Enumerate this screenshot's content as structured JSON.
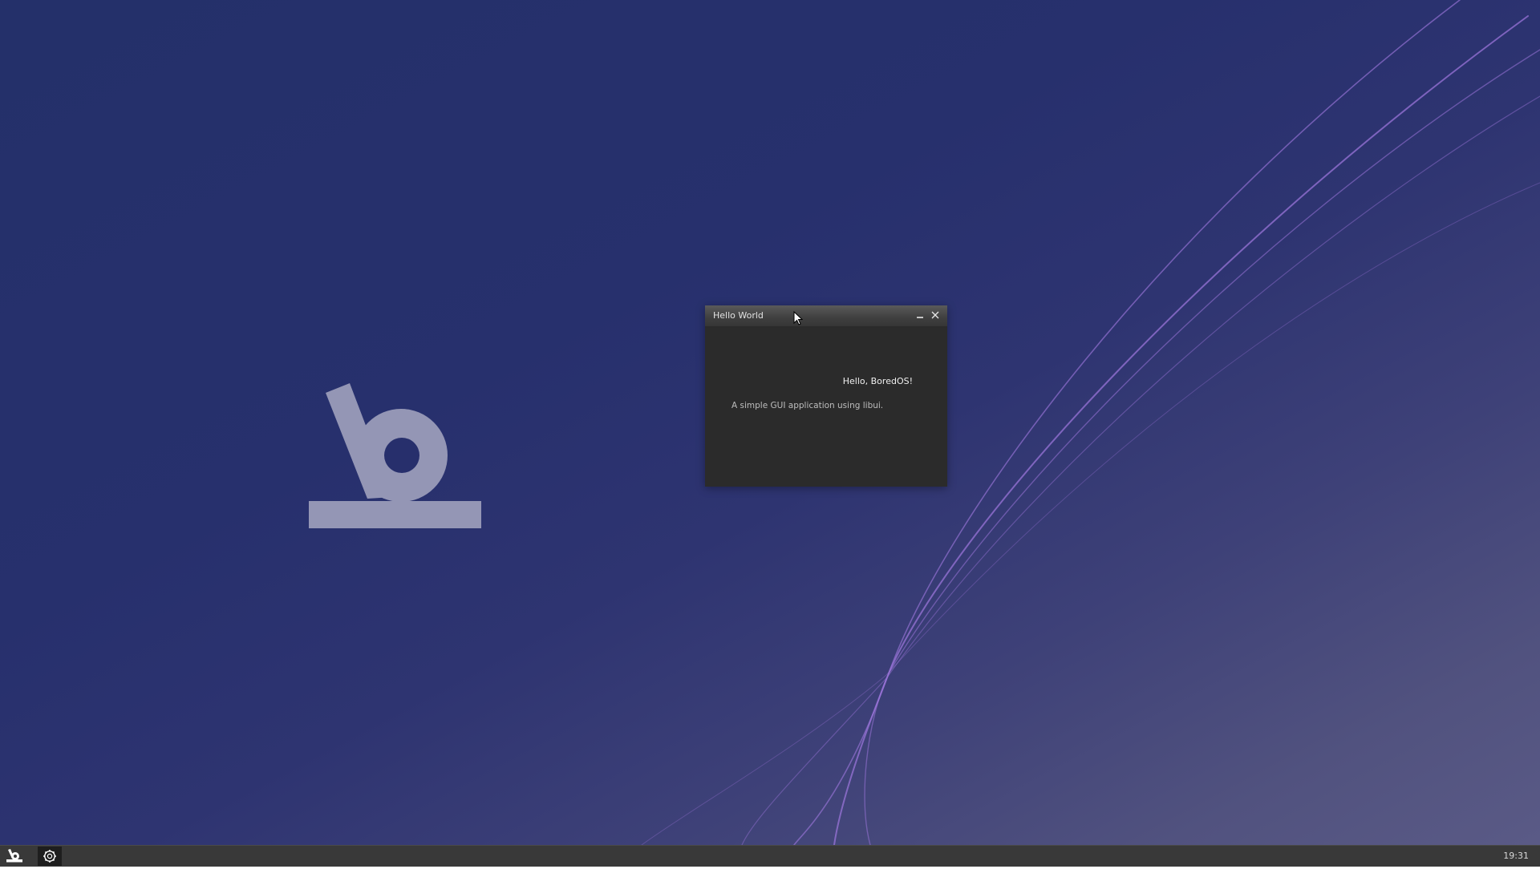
{
  "desktop": {
    "wallpaper_logo": "boredos-logo-icon",
    "colors": {
      "background_top": "#24306a",
      "background_bottom": "#5a5a86",
      "line_color": "#8a6bd0",
      "logo_color": "#9496b5"
    }
  },
  "window": {
    "title": "Hello World",
    "minimize_icon": "minimize-icon",
    "close_icon": "close-icon",
    "heading": "Hello, BoredOS!",
    "description": "A simple GUI application using libui.",
    "colors": {
      "body": "#2b2b2b",
      "text": "#f0f0f0",
      "muted_text": "#bdbdbd"
    }
  },
  "taskbar": {
    "start_icon": "boredos-logo-icon",
    "task_icon": "gear-icon",
    "clock": "19:31",
    "colors": {
      "background": "#393939"
    }
  }
}
